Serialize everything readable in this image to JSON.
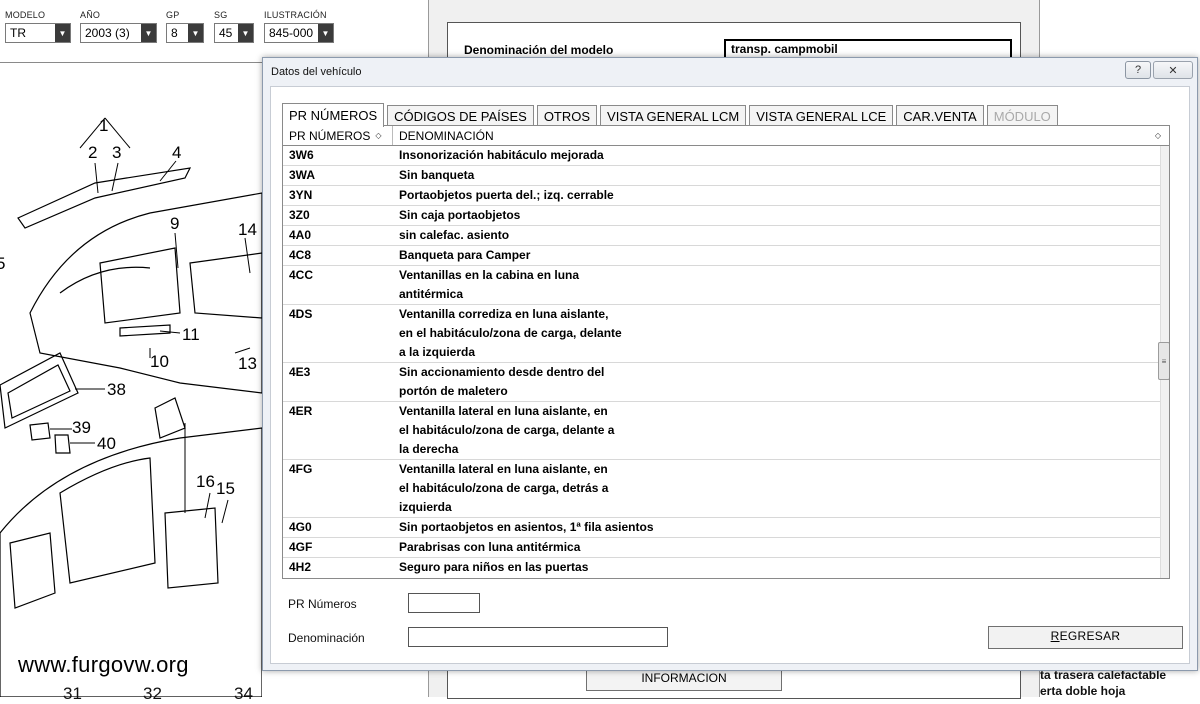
{
  "selectors": [
    {
      "label": "MODELO",
      "value": "TR"
    },
    {
      "label": "AÑO",
      "value": "2003 (3)"
    },
    {
      "label": "GP",
      "value": "8"
    },
    {
      "label": "SG",
      "value": "45"
    },
    {
      "label": "ILUSTRACIÓN",
      "value": "845-000"
    }
  ],
  "illustration": {
    "callouts": [
      "1",
      "2",
      "3",
      "4",
      "5",
      "9",
      "14",
      "11",
      "10",
      "13",
      "38",
      "39",
      "40",
      "16",
      "15"
    ],
    "bottom_numbers": [
      "31",
      "32",
      "34"
    ]
  },
  "watermark": "www.furgovw.org",
  "background_window": {
    "model_label": "Denominación del modelo",
    "model_value": "transp. campmobil",
    "info_button": "INFORMACION",
    "right_texts": [
      "ta trasera calefactable",
      "erta doble hoja"
    ]
  },
  "dialog": {
    "title": "Datos del vehículo",
    "help_button": "?",
    "close_button": "✕",
    "tabs": [
      {
        "label": "PR NÚMEROS",
        "state": "active"
      },
      {
        "label": "CÓDIGOS DE PAÍSES",
        "state": "normal"
      },
      {
        "label": "OTROS",
        "state": "normal"
      },
      {
        "label": "VISTA GENERAL LCM",
        "state": "normal"
      },
      {
        "label": "VISTA GENERAL LCE",
        "state": "normal"
      },
      {
        "label": "CAR.VENTA",
        "state": "normal"
      },
      {
        "label": "MÓDULO",
        "state": "disabled"
      }
    ],
    "grid": {
      "columns": [
        "PR NÚMEROS",
        "DENOMINACIÓN"
      ],
      "sort_icon": "◇",
      "rows": [
        {
          "code": "3W6",
          "desc": "Insonorización habitáculo mejorada"
        },
        {
          "code": "3WA",
          "desc": "Sin banqueta"
        },
        {
          "code": "3YN",
          "desc": "Portaobjetos puerta del.; izq. cerrable"
        },
        {
          "code": "3Z0",
          "desc": "Sin caja portaobjetos"
        },
        {
          "code": "4A0",
          "desc": "sin calefac. asiento"
        },
        {
          "code": "4C8",
          "desc": "Banqueta para Camper"
        },
        {
          "code": "4CC",
          "desc": "Ventanillas en la cabina en luna\nantitérmica"
        },
        {
          "code": "4DS",
          "desc": "Ventanilla corrediza en luna aislante,\nen el habitáculo/zona de carga, delante\na la izquierda"
        },
        {
          "code": "4E3",
          "desc": "Sin accionamiento desde dentro del\nportón de maletero"
        },
        {
          "code": "4ER",
          "desc": "Ventanilla lateral en luna aislante, en\nel habitáculo/zona de carga, delante a\nla derecha"
        },
        {
          "code": "4FG",
          "desc": "Ventanilla lateral en luna aislante, en\nel habitáculo/zona de carga, detrás a\nizquierda"
        },
        {
          "code": "4G0",
          "desc": "Sin portaobjetos en asientos, 1ª fila asientos"
        },
        {
          "code": "4GF",
          "desc": "Parabrisas con luna antitérmica"
        },
        {
          "code": "4H2",
          "desc": "Seguro para niños en las puertas\ncorredizas del habitáculo"
        }
      ]
    },
    "fields": {
      "pr_label": "PR Números",
      "pr_value": "",
      "denom_label": "Denominación",
      "denom_value": ""
    },
    "back_button": {
      "mnemonic": "R",
      "rest": "EGRESAR"
    }
  }
}
